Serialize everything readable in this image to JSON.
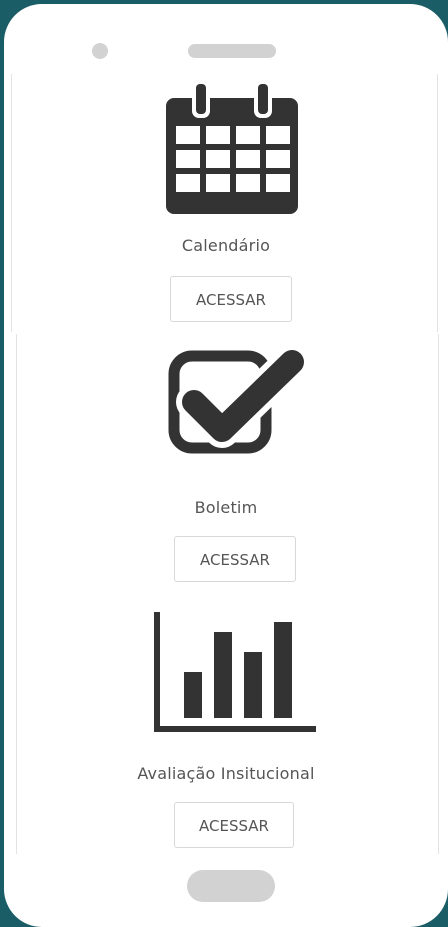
{
  "items": [
    {
      "label": "Calendário",
      "button_label": "ACESSAR",
      "icon": "calendar-icon"
    },
    {
      "label": "Boletim",
      "button_label": "ACESSAR",
      "icon": "checkbox-checked-icon"
    },
    {
      "label": "Avaliação Insitucional",
      "button_label": "ACESSAR",
      "icon": "bar-chart-icon"
    }
  ],
  "colors": {
    "background": "#1b5d66",
    "screen": "#ffffff",
    "icon": "#333333",
    "text": "#555555"
  }
}
